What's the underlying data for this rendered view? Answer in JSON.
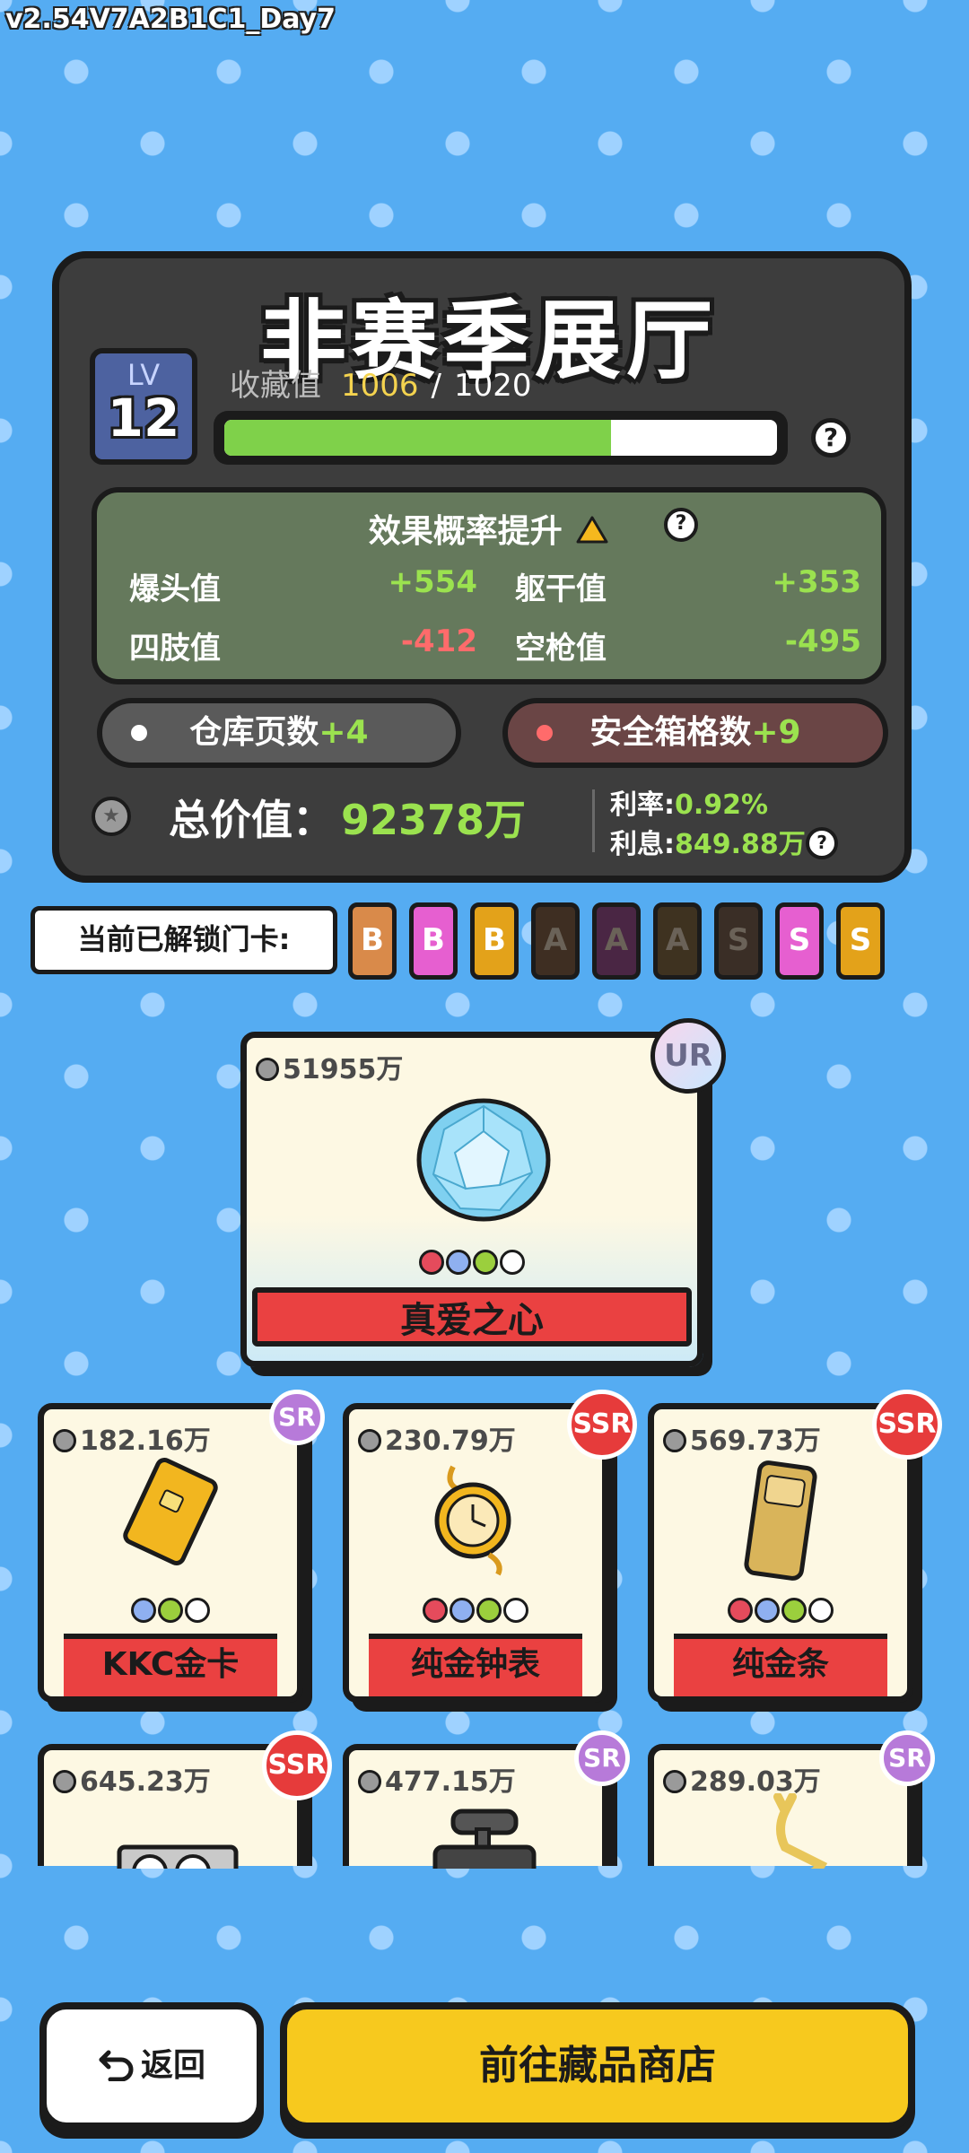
{
  "version": "v2.54V7A2B1C1_Day7",
  "hall": {
    "title": "非赛季展厅",
    "lv_label": "LV",
    "level": "12",
    "collect_label": "收藏值",
    "collect_current": "1006",
    "collect_sep": "/",
    "collect_total": "1020",
    "progress_fraction": 0.7
  },
  "effects": {
    "title": "效果概率提升",
    "items": [
      {
        "label": "爆头值",
        "value": "+554"
      },
      {
        "label": "躯干值",
        "value": "+353"
      },
      {
        "label": "四肢值",
        "value": "-412"
      },
      {
        "label": "空枪值",
        "value": "-495"
      }
    ]
  },
  "buttons": {
    "warehouse_label": "仓库页数",
    "warehouse_bonus": "+4",
    "safebox_label": "安全箱格数",
    "safebox_bonus": "+9",
    "back_label": "返回",
    "shop_label": "前往藏品商店"
  },
  "total": {
    "label": "总价值：",
    "value": "92378万",
    "rate_label": "利率:",
    "rate_value": "0.92%",
    "interest_label": "利息:",
    "interest_value": "849.88万"
  },
  "unlock": {
    "label": "当前已解锁门卡:",
    "cards": [
      {
        "letter": "B",
        "color": "#d98a4a",
        "locked": false
      },
      {
        "letter": "B",
        "color": "#e65fd0",
        "locked": false
      },
      {
        "letter": "B",
        "color": "#e3a21a",
        "locked": false
      },
      {
        "letter": "A",
        "color": "#3e2e22",
        "locked": true
      },
      {
        "letter": "A",
        "color": "#4a2644",
        "locked": true
      },
      {
        "letter": "A",
        "color": "#3e3220",
        "locked": true
      },
      {
        "letter": "S",
        "color": "#3a2e26",
        "locked": true
      },
      {
        "letter": "S",
        "color": "#e65fd0",
        "locked": false
      },
      {
        "letter": "S",
        "color": "#e3a21a",
        "locked": false
      }
    ]
  },
  "featured": {
    "price": "51955万",
    "rarity": "UR",
    "name": "真爱之心",
    "icon": "diamond-icon"
  },
  "items": [
    {
      "price": "182.16万",
      "rarity": "SR",
      "name": "KKC金卡",
      "icon": "gold-card-icon"
    },
    {
      "price": "230.79万",
      "rarity": "SSR",
      "name": "纯金钟表",
      "icon": "pocket-watch-icon"
    },
    {
      "price": "569.73万",
      "rarity": "SSR",
      "name": "纯金条",
      "icon": "gold-bar-icon"
    },
    {
      "price": "645.23万",
      "rarity": "SSR",
      "name": "",
      "icon": "graphics-card-icon"
    },
    {
      "price": "477.15万",
      "rarity": "SR",
      "name": "",
      "icon": "camera-icon"
    },
    {
      "price": "289.03万",
      "rarity": "SR",
      "name": "",
      "icon": "golden-deer-icon"
    }
  ],
  "colors": {
    "background": "#55acf2",
    "panel": "#3d3d3d",
    "green_accent": "#9be24f",
    "red_accent": "#ff6b6b",
    "ssr": "#e63b3b",
    "sr": "#b77ad9",
    "shop_button": "#f7c91e"
  }
}
